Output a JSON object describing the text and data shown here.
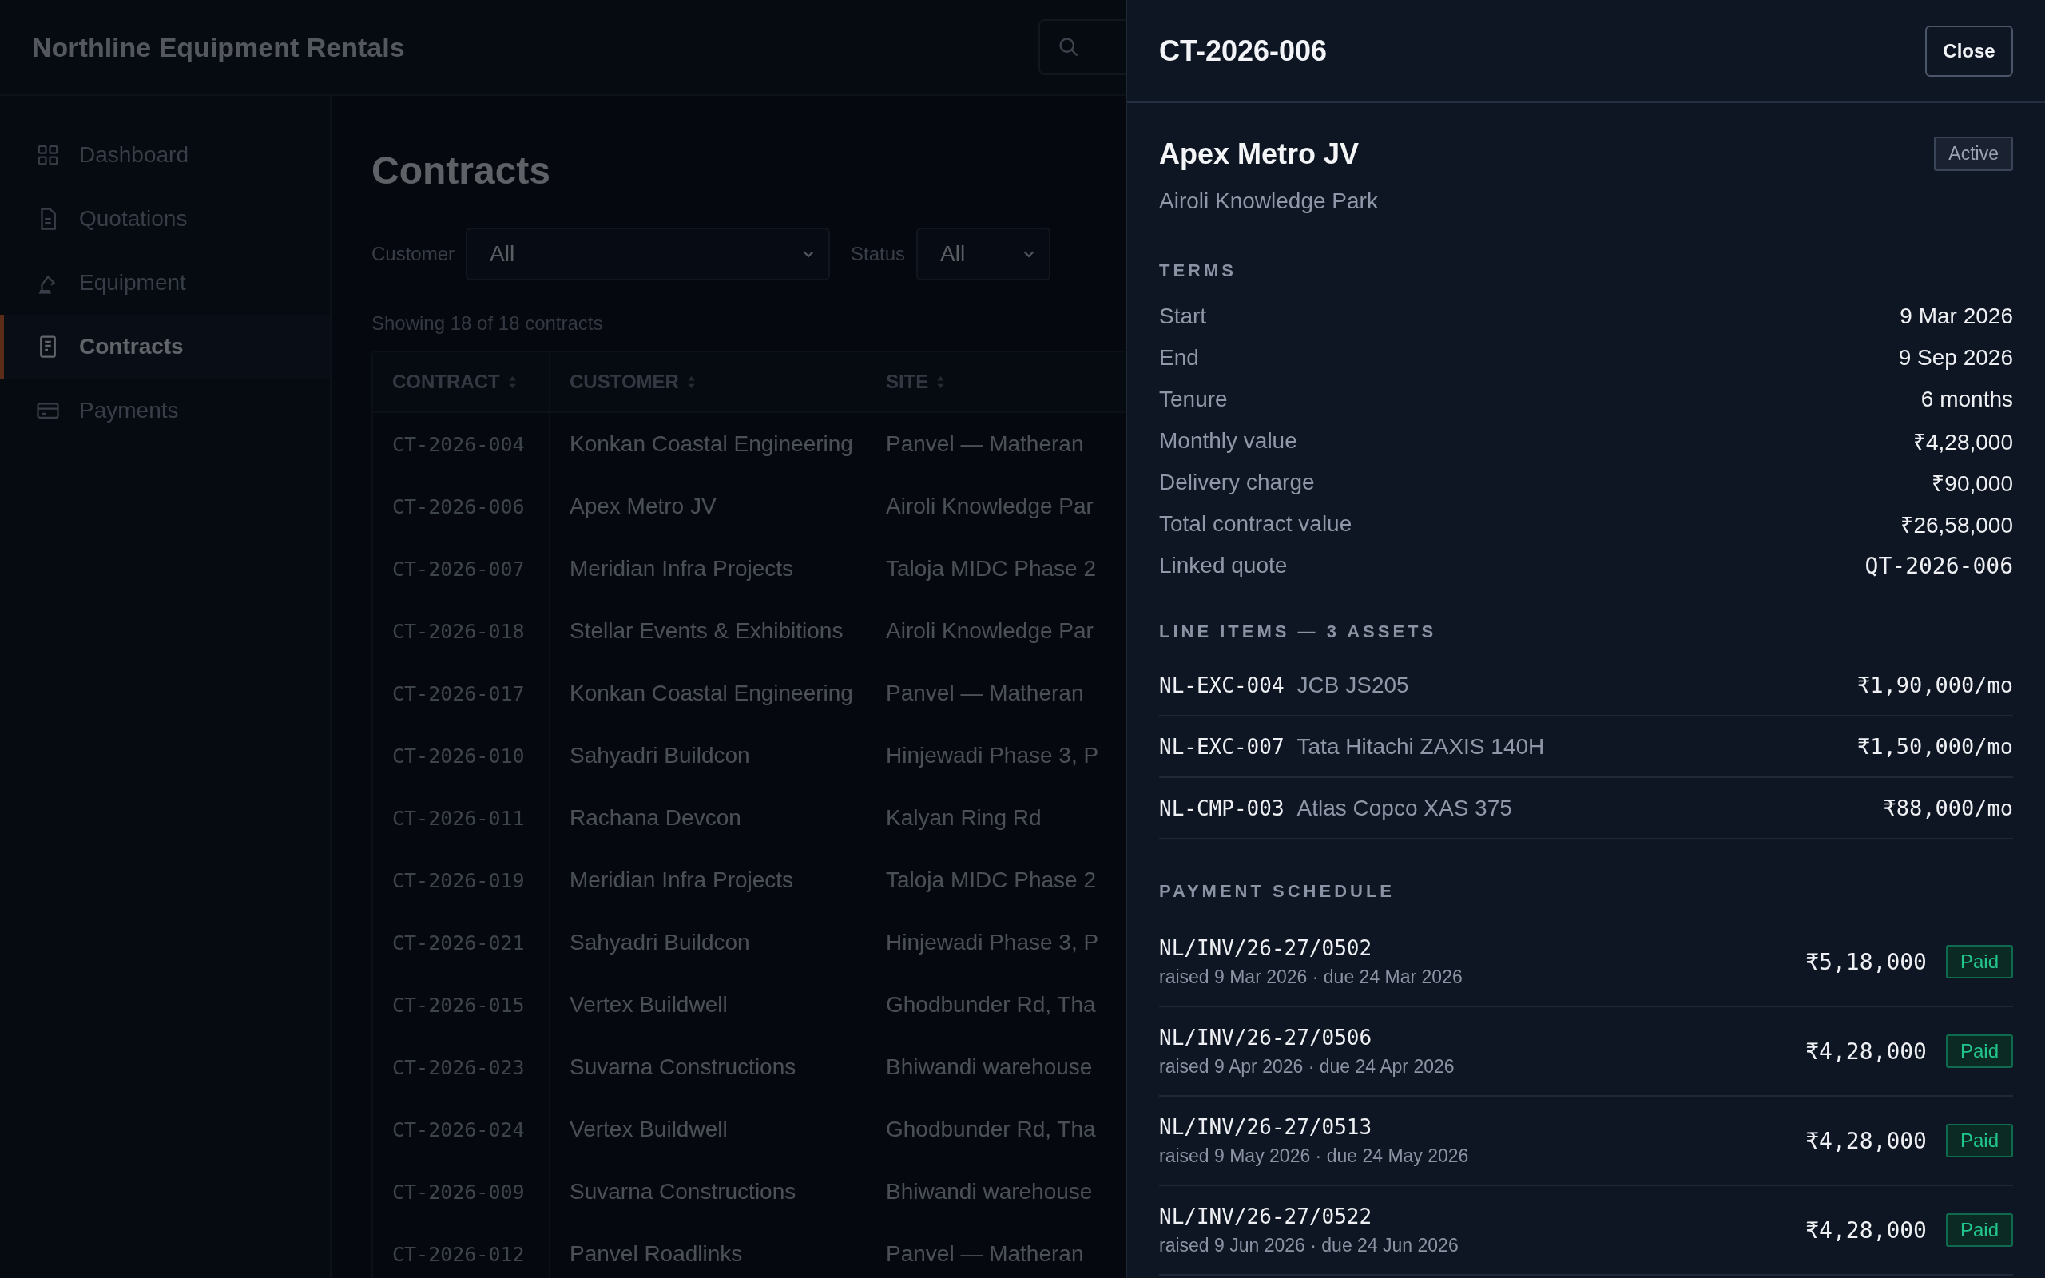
{
  "app": {
    "title": "Northline Equipment Rentals"
  },
  "sidebar": {
    "items": [
      {
        "label": "Dashboard",
        "kind": "grid",
        "selected": false
      },
      {
        "label": "Quotations",
        "kind": "document",
        "selected": false
      },
      {
        "label": "Equipment",
        "kind": "crane",
        "selected": false
      },
      {
        "label": "Contracts",
        "kind": "ledger",
        "selected": true
      },
      {
        "label": "Payments",
        "kind": "card",
        "selected": false
      }
    ]
  },
  "page": {
    "title": "Contracts",
    "filters": [
      {
        "label": "Customer",
        "value": "All",
        "kind": "wide"
      },
      {
        "label": "Status",
        "value": "All",
        "kind": "narrow"
      }
    ],
    "summary": "Showing 18 of 18 contracts"
  },
  "table": {
    "columns": [
      "CONTRACT",
      "CUSTOMER",
      "SITE"
    ],
    "rows": [
      {
        "contract": "CT-2026-004",
        "customer": "Konkan Coastal Engineering",
        "site": "Panvel — Matheran"
      },
      {
        "contract": "CT-2026-006",
        "customer": "Apex Metro JV",
        "site": "Airoli Knowledge Par"
      },
      {
        "contract": "CT-2026-007",
        "customer": "Meridian Infra Projects",
        "site": "Taloja MIDC Phase 2"
      },
      {
        "contract": "CT-2026-018",
        "customer": "Stellar Events & Exhibitions",
        "site": "Airoli Knowledge Par"
      },
      {
        "contract": "CT-2026-017",
        "customer": "Konkan Coastal Engineering",
        "site": "Panvel — Matheran"
      },
      {
        "contract": "CT-2026-010",
        "customer": "Sahyadri Buildcon",
        "site": "Hinjewadi Phase 3, P"
      },
      {
        "contract": "CT-2026-011",
        "customer": "Rachana Devcon",
        "site": "Kalyan Ring Rd"
      },
      {
        "contract": "CT-2026-019",
        "customer": "Meridian Infra Projects",
        "site": "Taloja MIDC Phase 2"
      },
      {
        "contract": "CT-2026-021",
        "customer": "Sahyadri Buildcon",
        "site": "Hinjewadi Phase 3, P"
      },
      {
        "contract": "CT-2026-015",
        "customer": "Vertex Buildwell",
        "site": "Ghodbunder Rd, Tha"
      },
      {
        "contract": "CT-2026-023",
        "customer": "Suvarna Constructions",
        "site": "Bhiwandi warehouse"
      },
      {
        "contract": "CT-2026-024",
        "customer": "Vertex Buildwell",
        "site": "Ghodbunder Rd, Tha"
      },
      {
        "contract": "CT-2026-009",
        "customer": "Suvarna Constructions",
        "site": "Bhiwandi warehouse"
      },
      {
        "contract": "CT-2026-012",
        "customer": "Panvel Roadlinks",
        "site": "Panvel — Matheran"
      }
    ]
  },
  "drawer": {
    "title": "CT-2026-006",
    "close": "Close",
    "customer": "Apex Metro JV",
    "site": "Airoli Knowledge Park",
    "status": "Active",
    "terms_heading": "TERMS",
    "terms": [
      {
        "label": "Start",
        "value": "9 Mar 2026",
        "kind": "text"
      },
      {
        "label": "End",
        "value": "9 Sep 2026",
        "kind": "text"
      },
      {
        "label": "Tenure",
        "value": "6 months",
        "kind": "text"
      },
      {
        "label": "Monthly value",
        "value": "₹4,28,000",
        "kind": "text"
      },
      {
        "label": "Delivery charge",
        "value": "₹90,000",
        "kind": "text"
      },
      {
        "label": "Total contract value",
        "value": "₹26,58,000",
        "kind": "text"
      },
      {
        "label": "Linked quote",
        "value": "QT-2026-006",
        "kind": "code"
      }
    ],
    "line_items_heading": "LINE ITEMS — 3 ASSETS",
    "line_items": [
      {
        "code": "NL-EXC-004",
        "name": "JCB JS205",
        "rate": "₹1,90,000/mo"
      },
      {
        "code": "NL-EXC-007",
        "name": "Tata Hitachi ZAXIS 140H",
        "rate": "₹1,50,000/mo"
      },
      {
        "code": "NL-CMP-003",
        "name": "Atlas Copco XAS 375",
        "rate": "₹88,000/mo"
      }
    ],
    "payments_heading": "PAYMENT SCHEDULE",
    "payments": [
      {
        "invoice": "NL/INV/26-27/0502",
        "dates": "raised 9 Mar 2026 · due 24 Mar 2026",
        "amount": "₹5,18,000",
        "status": "Paid"
      },
      {
        "invoice": "NL/INV/26-27/0506",
        "dates": "raised 9 Apr 2026 · due 24 Apr 2026",
        "amount": "₹4,28,000",
        "status": "Paid"
      },
      {
        "invoice": "NL/INV/26-27/0513",
        "dates": "raised 9 May 2026 · due 24 May 2026",
        "amount": "₹4,28,000",
        "status": "Paid"
      },
      {
        "invoice": "NL/INV/26-27/0522",
        "dates": "raised 9 Jun 2026 · due 24 Jun 2026",
        "amount": "₹4,28,000",
        "status": "Paid"
      }
    ]
  }
}
